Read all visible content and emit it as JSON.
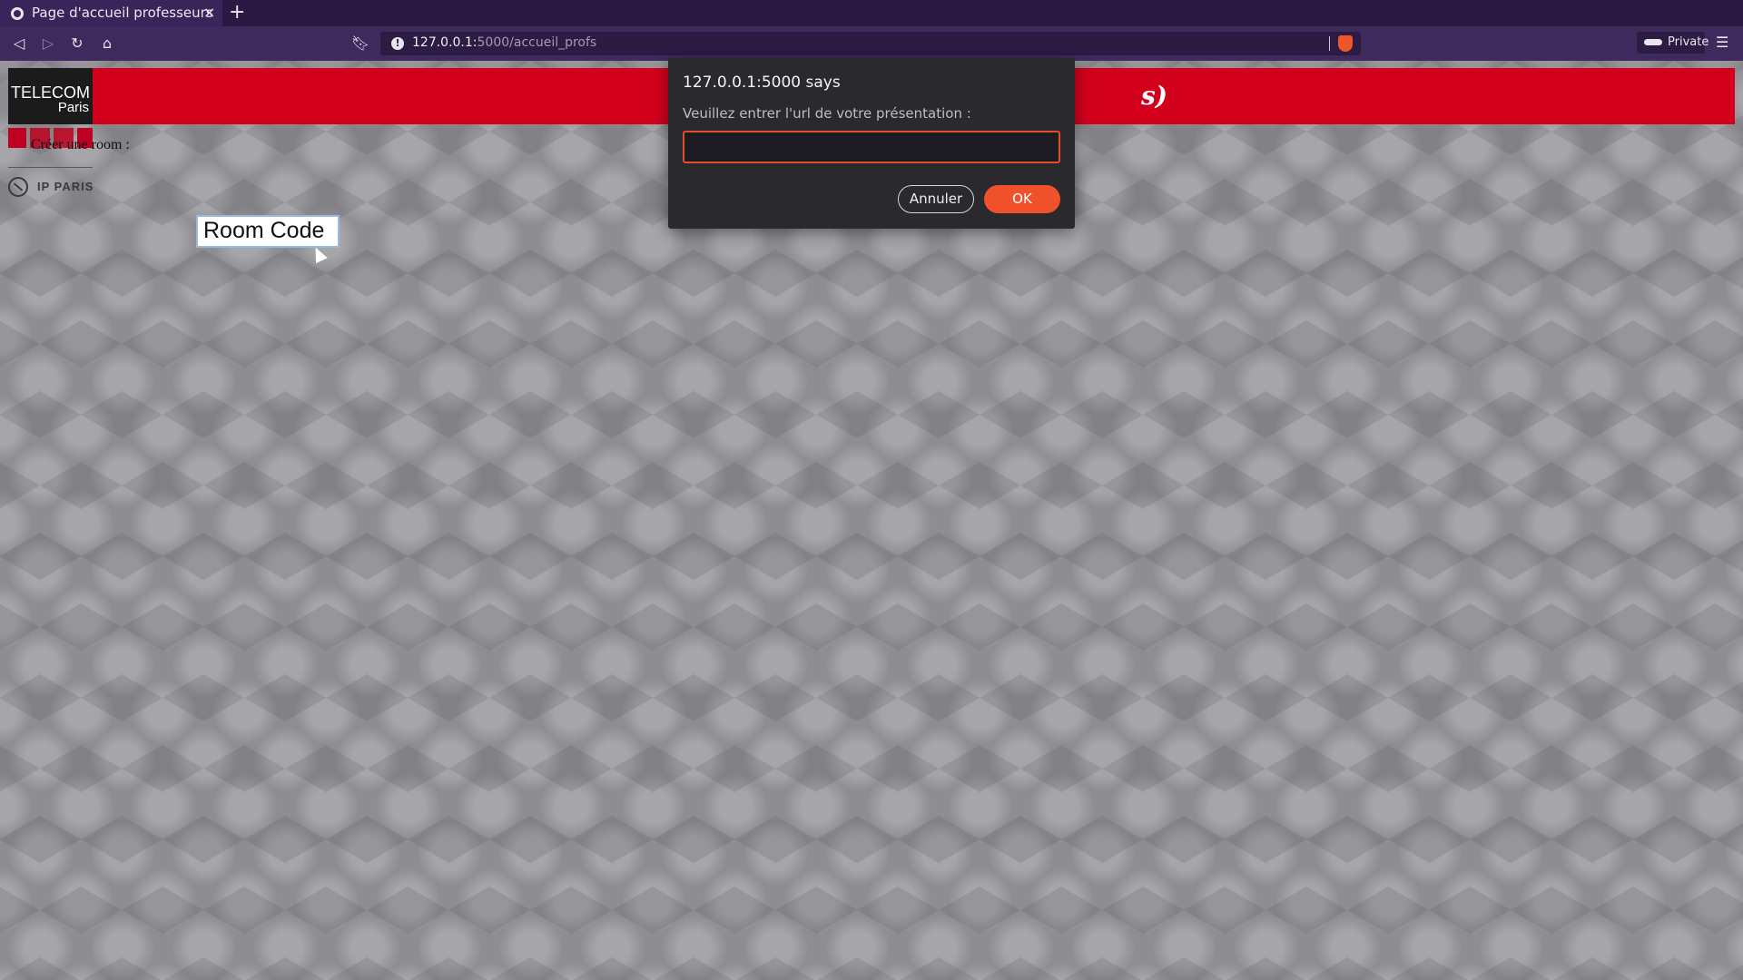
{
  "browser": {
    "tab_title": "Page d'accueil professeurs",
    "tab_close": "×",
    "new_tab": "+",
    "url_host": "127.0.0.1:",
    "url_path": "5000/accueil_profs",
    "private_label": "Private",
    "icons": {
      "back": "back-arrow-icon",
      "forward": "forward-arrow-icon",
      "reload": "reload-icon",
      "home": "home-icon",
      "bookmark": "bookmark-icon",
      "site_info": "info-icon",
      "shields": "brave-shield-icon",
      "private": "private-mask-icon",
      "menu": "hamburger-menu-icon"
    }
  },
  "page": {
    "banner_title_fragment": "s)",
    "banner_color": "#d3001c",
    "logo_telecom": {
      "line1": "TELECOM",
      "line2": "Paris"
    },
    "logo_ip": "IP PARIS",
    "nav_item": "Créer une room :",
    "room_code": "Room Code"
  },
  "dialog": {
    "origin": "127.0.0.1:5000 says",
    "message": "Veuillez entrer l'url de votre présentation :",
    "input_value": "",
    "cancel_label": "Annuler",
    "ok_label": "OK",
    "accent_color": "#f0512a"
  }
}
